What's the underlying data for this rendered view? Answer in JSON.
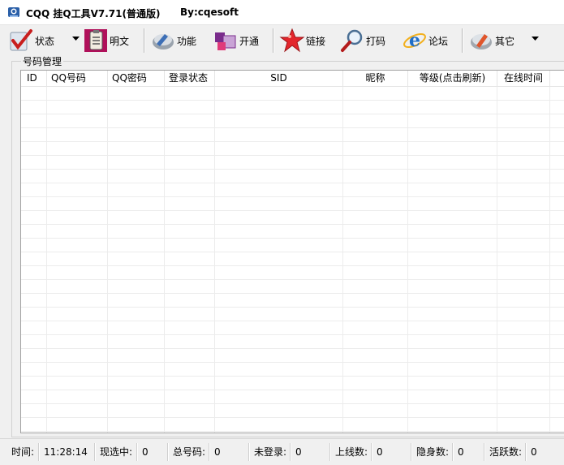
{
  "window": {
    "title": "CQQ 挂Q工具V7.71(普通版)",
    "author": "By:cqesoft"
  },
  "toolbar": {
    "items": [
      {
        "label": "状态",
        "icon": "status-check-icon",
        "dropdown": true
      },
      {
        "label": "明文",
        "icon": "clipboard-icon",
        "dropdown": false
      },
      {
        "label": "功能",
        "icon": "function-icon",
        "dropdown": false
      },
      {
        "label": "开通",
        "icon": "open-service-icon",
        "dropdown": false
      },
      {
        "label": "链接",
        "icon": "star-link-icon",
        "dropdown": false
      },
      {
        "label": "打码",
        "icon": "magnifier-icon",
        "dropdown": false
      },
      {
        "label": "论坛",
        "icon": "forum-ie-icon",
        "dropdown": false
      },
      {
        "label": "其它",
        "icon": "other-icon",
        "dropdown": true
      }
    ]
  },
  "account_group": {
    "label": "号码管理",
    "columns": [
      "ID",
      "QQ号码",
      "QQ密码",
      "登录状态",
      "SID",
      "昵称",
      "等级(点击刷新)",
      "在线时间"
    ],
    "rows": []
  },
  "statusbar": {
    "time_label": "时间:",
    "time_value": "11:28:14",
    "selected_label": "现选中:",
    "selected_value": "0",
    "total_label": "总号码:",
    "total_value": "0",
    "not_logged_label": "未登录:",
    "not_logged_value": "0",
    "online_label": "上线数:",
    "online_value": "0",
    "hidden_label": "隐身数:",
    "hidden_value": "0",
    "active_label": "活跃数:",
    "active_value": "0"
  },
  "colors": {
    "window_bg": "#f0f0f0",
    "list_bg": "#ffffff",
    "grid_line": "#ececec"
  }
}
